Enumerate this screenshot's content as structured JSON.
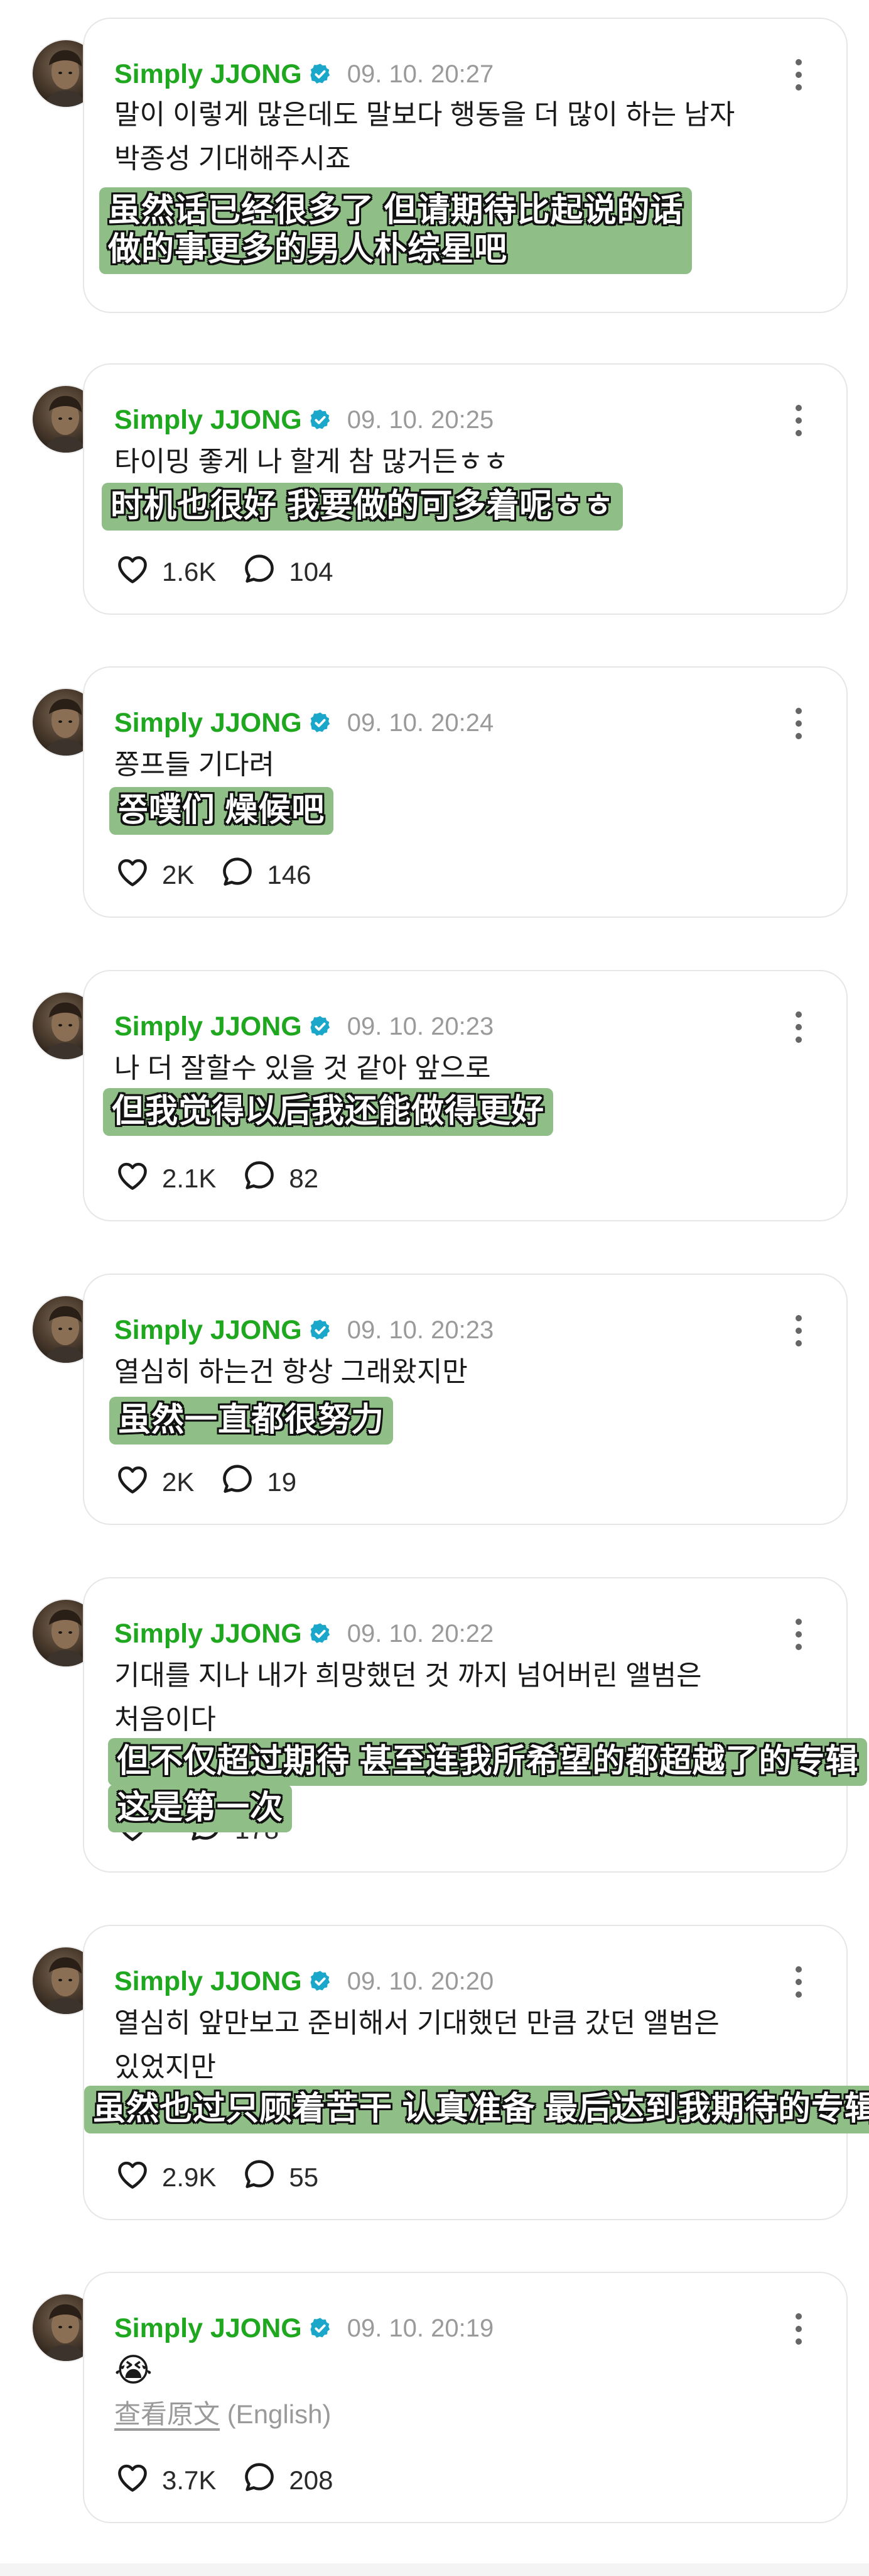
{
  "theme": {
    "username_color": "#1fa81f",
    "verified_color": "#1aa7c9",
    "subtitle_bg": "#8fbf86",
    "border_color": "#e6e6e6",
    "meta_color": "#9a9a9a"
  },
  "icons": {
    "verified": "verified-badge-icon",
    "more": "more-vertical-icon",
    "like": "heart-icon",
    "reply": "speech-bubble-icon"
  },
  "posts": [
    {
      "username": "Simply JJONG",
      "timestamp": "09. 10. 20:27",
      "text": "말이 이렇게 많은데도 말보다 행동을 더 많이 하는 남자\n박종성 기대해주시죠",
      "subtitle": "虽然话已经很多了 但请期待比起说的话\n做的事更多的男人朴综星吧"
    },
    {
      "username": "Simply JJONG",
      "timestamp": "09. 10. 20:25",
      "text": "타이밍 좋게 나 할게 참 많거든ㅎㅎ",
      "subtitle": "时机也很好 我要做的可多着呢ㅎㅎ",
      "likes": "1.6K",
      "replies": "104"
    },
    {
      "username": "Simply JJONG",
      "timestamp": "09. 10. 20:24",
      "text": "쫑프들 기다려",
      "subtitle": "쫑噗们 燥候吧",
      "likes": "2K",
      "replies": "146"
    },
    {
      "username": "Simply JJONG",
      "timestamp": "09. 10. 20:23",
      "text": "나 더 잘할수 있을 것 같아 앞으로",
      "subtitle": "但我觉得以后我还能做得更好",
      "likes": "2.1K",
      "replies": "82"
    },
    {
      "username": "Simply JJONG",
      "timestamp": "09. 10. 20:23",
      "text": "열심히 하는건 항상 그래왔지만",
      "subtitle": "虽然一直都很努力",
      "likes": "2K",
      "replies": "19"
    },
    {
      "username": "Simply JJONG",
      "timestamp": "09. 10. 20:22",
      "text": "기대를 지나 내가 희망했던 것 까지 넘어버린 앨범은\n처음이다",
      "subtitle_line1": "但不仅超过期待 甚至连我所希望的都超越了的专辑",
      "subtitle_line2": "这是第一次",
      "replies": "178"
    },
    {
      "username": "Simply JJONG",
      "timestamp": "09. 10. 20:20",
      "text": "열심히 앞만보고 준비해서 기대했던 만큼 갔던 앨범은\n있었지만",
      "subtitle": "虽然也过只顾着苦干 认真准备 最后达到我期待的专辑",
      "likes": "2.9K",
      "replies": "55"
    },
    {
      "username": "Simply JJONG",
      "timestamp": "09. 10. 20:19",
      "emoji": "😭",
      "see_original": "查看原文",
      "language": "(English)",
      "likes": "3.7K",
      "replies": "208"
    }
  ]
}
